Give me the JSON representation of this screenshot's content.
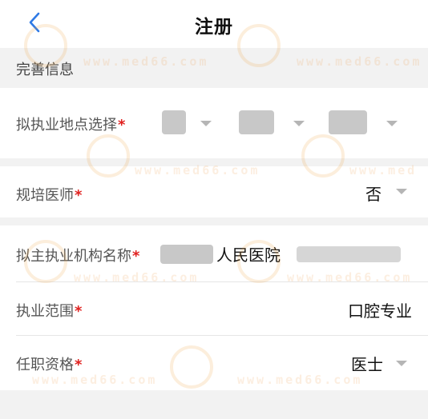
{
  "nav": {
    "title": "注册",
    "back_icon": "chevron-left-icon"
  },
  "section": {
    "title": "完善信息"
  },
  "form": {
    "location": {
      "label": "拟执业地点选择",
      "required_mark": "*",
      "province_suffix": "",
      "city_suffix": "",
      "district_suffix": ""
    },
    "residency": {
      "label": "规培医师",
      "required_mark": "*",
      "value": "否"
    },
    "institution": {
      "label": "拟主执业机构名称",
      "required_mark": "*",
      "value": "人民医院"
    },
    "scope": {
      "label": "执业范围",
      "required_mark": "*",
      "value": "口腔专业"
    },
    "qualification": {
      "label": "任职资格",
      "required_mark": "*",
      "value": "医士"
    }
  },
  "colors": {
    "required": "#e0211f",
    "accent": "#2f7ae5",
    "section_bg": "#f2f2f2"
  }
}
